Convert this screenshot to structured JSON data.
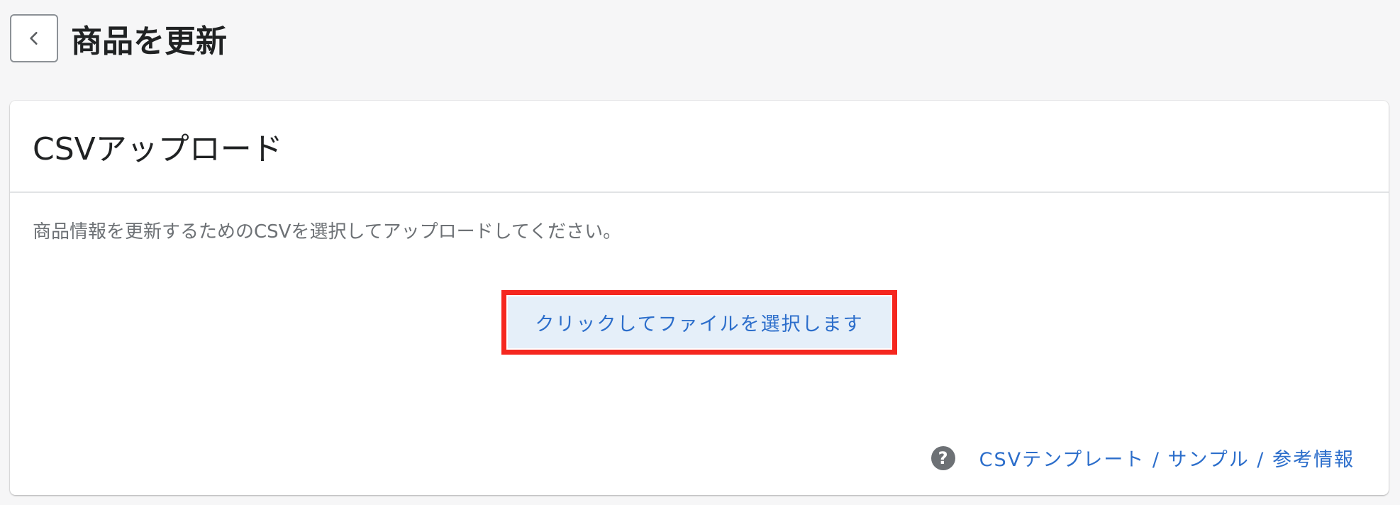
{
  "header": {
    "back_icon": "chevron-left-icon",
    "title": "商品を更新"
  },
  "card": {
    "title": "CSVアップロード",
    "description": "商品情報を更新するためのCSVを選択してアップロードしてください。",
    "select_file_label": "クリックしてファイルを選択します",
    "help_icon": "question-circle-icon",
    "help_icon_glyph": "?",
    "help_link_label": "CSVテンプレート / サンプル / 参考情報"
  },
  "colors": {
    "accent": "#2c6ecb",
    "button_background": "#e5eff9",
    "highlight_border": "#f5271f",
    "page_background": "#f6f6f7"
  }
}
